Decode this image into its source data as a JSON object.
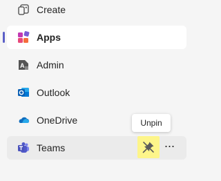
{
  "nav": {
    "items": [
      {
        "label": "Create",
        "icon": "create-icon"
      },
      {
        "label": "Apps",
        "icon": "apps-icon",
        "selected": true
      },
      {
        "label": "Admin",
        "icon": "admin-icon"
      },
      {
        "label": "Outlook",
        "icon": "outlook-icon"
      },
      {
        "label": "OneDrive",
        "icon": "onedrive-icon"
      },
      {
        "label": "Teams",
        "icon": "teams-icon"
      }
    ]
  },
  "tooltip": {
    "text": "Unpin"
  },
  "actions": {
    "more_glyph": "···",
    "unpin_icon": "unpin-icon"
  },
  "colors": {
    "accent": "#5b5fc7",
    "highlight": "#fdf58a"
  }
}
